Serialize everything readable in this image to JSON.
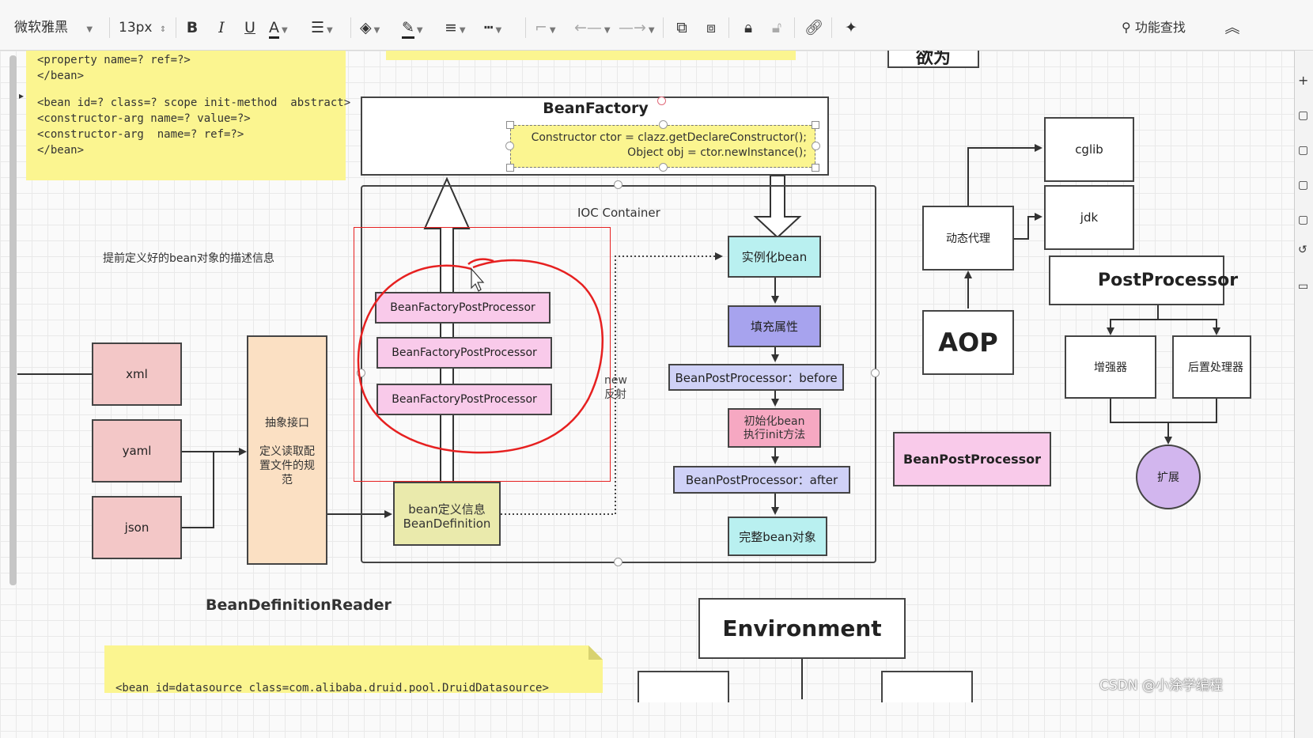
{
  "toolbar": {
    "font_family": "微软雅黑",
    "font_size": "13px",
    "bold": "B",
    "italic": "I",
    "underline": "U",
    "font_color": "A",
    "search_label": "功能查找"
  },
  "notes": {
    "top_note_lines": [
      "<property name=? ref=?>",
      "</bean>",
      "",
      "<bean id=? class=? scope init-method  abstract>",
      "<constructor-arg name=? value=?>",
      "<constructor-arg  name=? ref=?>",
      "</bean>"
    ],
    "bottom_note_line": "<bean id=datasource class=com.alibaba.druid.pool.DruidDatasource>"
  },
  "diagram": {
    "behavior_title": "欲为",
    "bean_factory": "BeanFactory",
    "constructor_line1": "Constructor ctor = clazz.getDeclareConstructor();",
    "constructor_line2": "Object obj = ctor.newInstance();",
    "ioc_container": "IOC  Container",
    "predefined_desc": "提前定义好的bean对象的描述信息",
    "xml": "xml",
    "yaml": "yaml",
    "json": "json",
    "abstract_interface": "抽象接口",
    "reader_desc": "定义读取配置文件的规范",
    "bean_definition_reader": "BeanDefinitionReader",
    "bfpp": [
      "BeanFactoryPostProcessor",
      "BeanFactoryPostProcessor",
      "BeanFactoryPostProcessor"
    ],
    "bean_definition_line1": "bean定义信息",
    "bean_definition_line2": "BeanDefinition",
    "new_reflect_line1": "new",
    "new_reflect_line2": "反射",
    "instantiate": "实例化bean",
    "populate": "填充属性",
    "bpp_before": "BeanPostProcessor：before",
    "init_line1": "初始化bean",
    "init_line2": "执行init方法",
    "bpp_after": "BeanPostProcessor：after",
    "complete": "完整bean对象",
    "cglib": "cglib",
    "jdk": "jdk",
    "dynamic_proxy": "动态代理",
    "aop": "AOP",
    "post_processor": "PostProcessor",
    "enhancer": "增强器",
    "post_handler": "后置处理器",
    "extend": "扩展",
    "bean_post_processor": "BeanPostProcessor",
    "environment": "Environment"
  },
  "watermark": "CSDN @小涂学编程",
  "colors": {
    "pink": "#f9caea",
    "salmon": "#f3c7c7",
    "peach": "#fbe0c3",
    "khaki": "#eaeaac",
    "cyan": "#b9f0f0",
    "blue": "#a7a3ee",
    "lavender": "#cfd1f7",
    "rose": "#f6a8c2",
    "purple": "#d2b6ee",
    "red": "#e62020"
  }
}
